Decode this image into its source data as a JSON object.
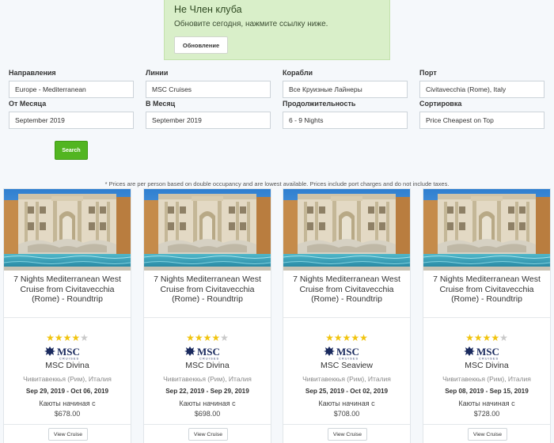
{
  "notice": {
    "title": "Не Член клуба",
    "text": "Обновите сегодня, нажмите ссылку ниже.",
    "button": "Обновление"
  },
  "filters": {
    "destination": {
      "label": "Направления",
      "value": "Europe - Mediterranean"
    },
    "line": {
      "label": "Линии",
      "value": "MSC Cruises"
    },
    "ships": {
      "label": "Корабли",
      "value": "Все Круизные Лайнеры"
    },
    "port": {
      "label": "Порт",
      "value": "Civitavecchia (Rome), Italy"
    },
    "from_month": {
      "label": "От Месяца",
      "value": "September 2019"
    },
    "to_month": {
      "label": "В Месяц",
      "value": "September 2019"
    },
    "duration": {
      "label": "Продолжительность",
      "value": "6 - 9 Nights"
    },
    "sort": {
      "label": "Сортировка",
      "value": "Price Cheapest on Top"
    },
    "search_button": "Search"
  },
  "disclaimer": "* Prices are per person based on double occupancy and are lowest available. Prices include port charges and do not include taxes.",
  "brand": {
    "logo_text": "MSC",
    "logo_sub": "CRUISES",
    "star_color": "#f1c40f",
    "accent_green": "#52b521"
  },
  "cards": [
    {
      "title": "7 Nights Mediterranean West Cruise from Civitavecchia (Rome) - Roundtrip",
      "rating": 4,
      "ship": "MSC Divina",
      "port": "Чивитавеккья (Рим), Италия",
      "dates": "Sep 29, 2019 - Oct 06, 2019",
      "from_label": "Каюты начиная с",
      "price": "$678.00",
      "button": "View Cruise"
    },
    {
      "title": "7 Nights Mediterranean West Cruise from Civitavecchia (Rome) - Roundtrip",
      "rating": 4,
      "ship": "MSC Divina",
      "port": "Чивитавеккья (Рим), Италия",
      "dates": "Sep 22, 2019 - Sep 29, 2019",
      "from_label": "Каюты начиная с",
      "price": "$698.00",
      "button": "View Cruise"
    },
    {
      "title": "7 Nights Mediterranean West Cruise from Civitavecchia (Rome) - Roundtrip",
      "rating": 5,
      "ship": "MSC Seaview",
      "port": "Чивитавеккья (Рим), Италия",
      "dates": "Sep 25, 2019 - Oct 02, 2019",
      "from_label": "Каюты начиная с",
      "price": "$708.00",
      "button": "View Cruise"
    },
    {
      "title": "7 Nights Mediterranean West Cruise from Civitavecchia (Rome) - Roundtrip",
      "rating": 4,
      "ship": "MSC Divina",
      "port": "Чивитавеккья (Рим), Италия",
      "dates": "Sep 08, 2019 - Sep 15, 2019",
      "from_label": "Каюты начиная с",
      "price": "$728.00",
      "button": "View Cruise"
    }
  ]
}
